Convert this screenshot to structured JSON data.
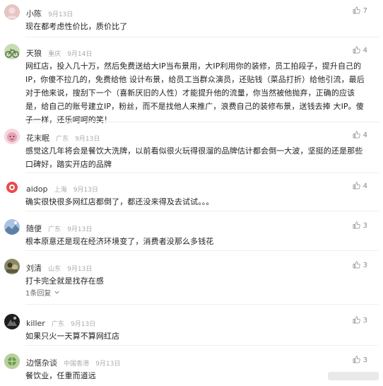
{
  "comments": [
    {
      "name": "小陈",
      "location": "",
      "time": "9月13日",
      "likes": "7",
      "text": "现在都考虑性价比，质价比了",
      "avatar_color": "#e7c4c4"
    },
    {
      "name": "天狼",
      "location": "重庆",
      "time": "9月14日",
      "likes": "4",
      "text": "网红店，投入几十万，然后免费送给大IP当布景用，大IP利用你的装修，员工拍段子，提升自己的IP，你傻不拉几的，免费给他 设计布景，给员工当群众演员，还贴钱（菜品打折）给他引流，最后对于他来说，搜刮下一个（喜新厌旧的人性）才能提升他的流量，你当然被他抛弃，正确的应该是，给自己的账号建立IP，粉丝，而不是找他人来推广，浪费自己的装修布景，送钱去捧 大IP。傻子一样，还乐呵呵的笑！",
      "avatar_color": "#9bbf7a"
    },
    {
      "name": "花末眠",
      "location": "广东",
      "time": "9月13日",
      "likes": "4",
      "text": "感觉这几年将会是餐饮大洗牌，以前看似很火玩得很溜的品牌估计都会倒一大波，坚挺的还是那些口碑好，踏实开店的品牌",
      "avatar_color": "#d98fa0"
    },
    {
      "name": "aidop",
      "location": "上海",
      "time": "9月13日",
      "likes": "4",
      "text": "确实很快很多网红店都倒了，都还没来得及去试试。。。",
      "avatar_color": "#e94b4b"
    },
    {
      "name": "随便",
      "location": "广东",
      "time": "9月13日",
      "likes": "3",
      "text": "根本原意还是现在经济环境变了，消费者没那么多钱花",
      "avatar_color": "#7d9fc4"
    },
    {
      "name": "刘清",
      "location": "山东",
      "time": "9月13日",
      "likes": "3",
      "text": "打卡完全就是找存在感",
      "replies": "1条回复",
      "avatar_color": "#6b6b4e"
    },
    {
      "name": "killer",
      "location": "广东",
      "time": "9月13日",
      "likes": "3",
      "text": "如果只火一天算不算网红店",
      "avatar_color": "#333333"
    },
    {
      "name": "边惬杂谈",
      "location": "中国香港",
      "time": "9月13日",
      "likes": "3",
      "text": "餐饮业，任重而道远",
      "avatar_color": "#7fa86a"
    }
  ]
}
